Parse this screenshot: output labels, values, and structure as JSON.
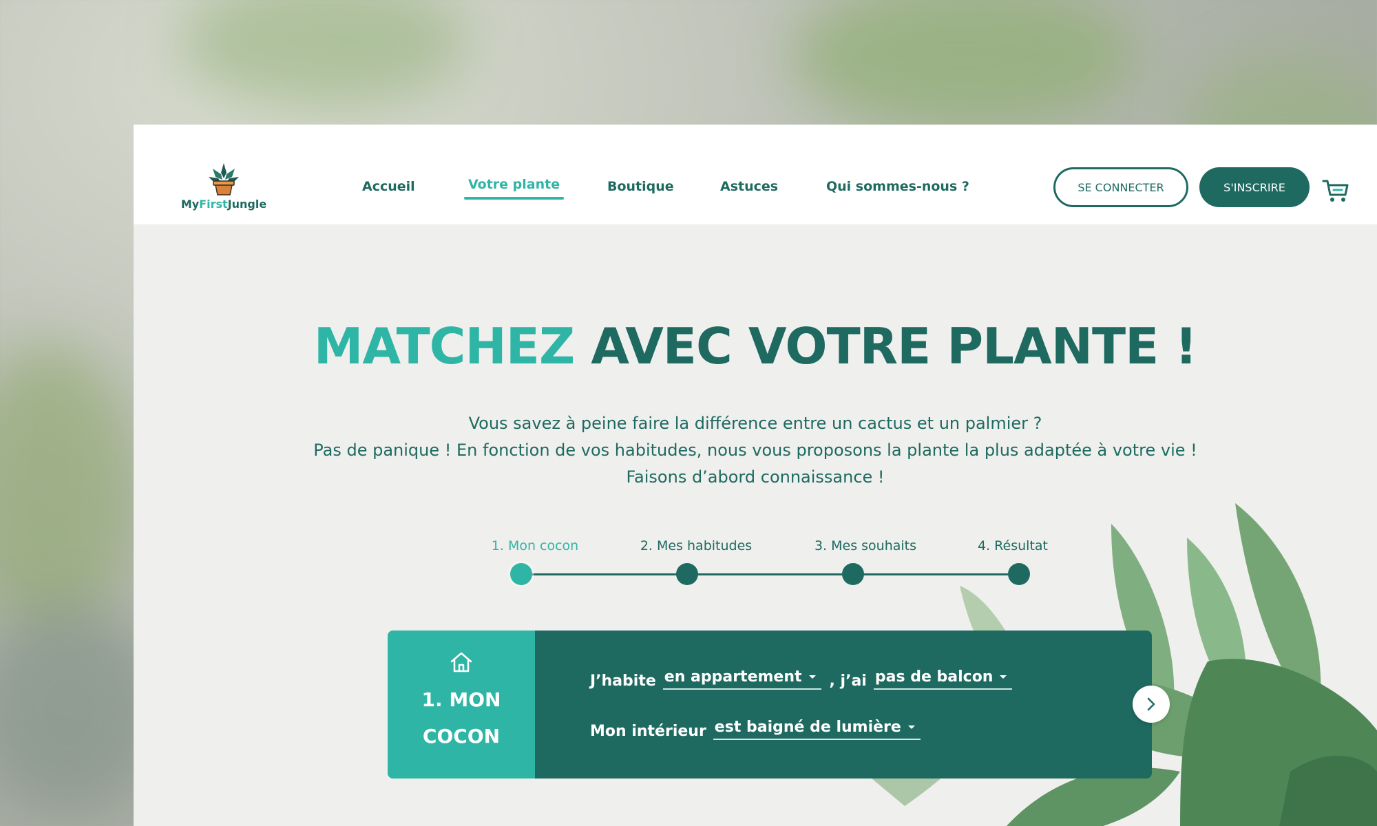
{
  "brand": {
    "logo_part1": "My",
    "logo_part2": "First",
    "logo_part3": "Jungle",
    "primary_color": "#1e6a61",
    "accent_color": "#2fb5a5"
  },
  "nav": {
    "items": [
      {
        "label": "Accueil",
        "active": false
      },
      {
        "label": "Votre plante",
        "active": true
      },
      {
        "label": "Boutique",
        "active": false
      },
      {
        "label": "Astuces",
        "active": false
      },
      {
        "label": "Qui sommes-nous ?",
        "active": false
      }
    ],
    "login_label": "SE CONNECTER",
    "signup_label": "S'INSCRIRE",
    "cart_icon": "cart-icon"
  },
  "hero": {
    "title_accent": "MATCHEZ",
    "title_rest": "AVEC VOTRE PLANTE !",
    "lines": [
      "Vous savez à peine faire la différence entre un cactus et un palmier ?",
      "Pas de panique ! En fonction de vos habitudes, nous vous proposons la plante la plus adaptée à votre vie !",
      "Faisons d’abord connaissance !"
    ]
  },
  "steps": [
    {
      "label": "1. Mon cocon",
      "active": true
    },
    {
      "label": "2. Mes habitudes",
      "active": false
    },
    {
      "label": "3. Mes souhaits",
      "active": false
    },
    {
      "label": "4. Résultat",
      "active": false
    }
  ],
  "card": {
    "icon": "home-icon",
    "title": "1. MON COCON",
    "row1": {
      "prefix": "J’habite",
      "select1": "en appartement",
      "sep": ", j’ai",
      "select2": "pas de balcon"
    },
    "row2": {
      "prefix": "Mon intérieur",
      "select1": "est baigné de lumière"
    },
    "next_icon": "chevron-right-icon"
  }
}
